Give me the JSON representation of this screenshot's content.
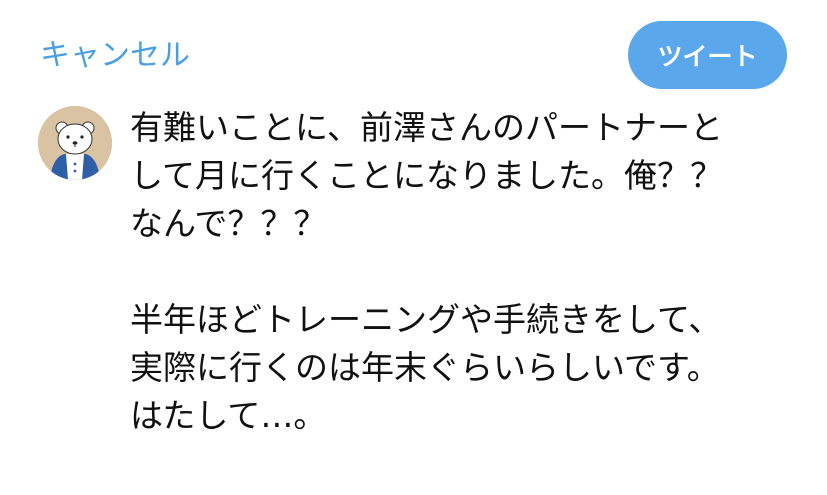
{
  "header": {
    "cancel_label": "キャンセル",
    "tweet_label": "ツイート"
  },
  "colors": {
    "accent": "#4a9fe3",
    "button_bg": "#5aa7ec",
    "avatar_bg": "#d9c3a2",
    "text": "#111111"
  },
  "avatar": {
    "icon": "polar-bear-avatar-icon"
  },
  "tweet": {
    "paragraph1": [
      "有難いことに、前澤さんのパートナーと",
      "して月に行くことになりました。俺？？",
      "なんで？？？"
    ],
    "paragraph2": [
      "半年ほどトレーニングや手続きをして、",
      "実際に行くのは年末ぐらいらしいです。",
      "はたして…。"
    ]
  }
}
